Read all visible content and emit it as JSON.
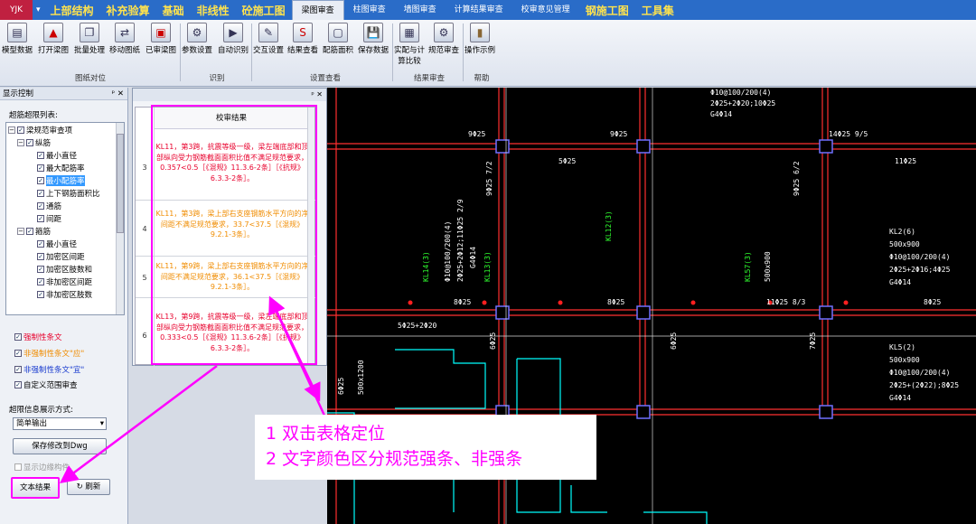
{
  "menubar": {
    "logo": "YJK",
    "items": [
      "上部结构",
      "补充验算",
      "基础",
      "非线性",
      "砼施工图"
    ],
    "tabs": [
      "梁图审查",
      "柱图审查",
      "墙图审查",
      "计算结果审查",
      "校审意见管理"
    ],
    "items2": [
      "钢施工图",
      "工具集"
    ]
  },
  "ribbon": {
    "buttons": [
      "模型数据",
      "打开梁图",
      "批量处理",
      "移动图纸",
      "已审梁图",
      "参数设置",
      "自动识别",
      "交互设置",
      "结果查看",
      "配筋面积",
      "保存数据",
      "实配与计算比较",
      "规范审查",
      "操作示例"
    ],
    "groups": [
      "图纸对位",
      "识别",
      "设置查看",
      "结果审查",
      "帮助"
    ]
  },
  "left_panel": {
    "title": "显示控制",
    "list_label": "超筋超限列表:",
    "tree": [
      "梁规范审查项",
      "纵筋",
      "最小直径",
      "最大配筋率",
      "最小配筋率",
      "上下钢筋面积比",
      "通筋",
      "间距",
      "箍筋",
      "最小直径",
      "加密区间距",
      "加密区肢数和",
      "非加密区间距",
      "非加密区肢数"
    ],
    "checks": [
      "强制性条文",
      "非强制性条文\"应\"",
      "非强制性条文\"宜\"",
      "自定义范围审查"
    ],
    "display_mode_label": "超限信息展示方式:",
    "display_mode_value": "简单输出",
    "save_button": "保存修改到Dwg",
    "show_boundary": "显示边缘构件",
    "text_result_button": "文本结果",
    "refresh_button": "刷新"
  },
  "colors": {
    "strong": "#e8002c",
    "should": "#f08c00",
    "advisory": "#1a3ccf",
    "annot": "#ff00ff"
  },
  "results": {
    "header": "校审结果",
    "rows": [
      {
        "num": "3",
        "text": "KL11，第3跨，抗震等级一级，梁左端底部和顶部纵向受力钢筋截面面积比值不满足规范要求，0.357<0.5［《混规》11.3.6-2条］［《抗规》6.3.3-2条］。",
        "level": "strong"
      },
      {
        "num": "4",
        "text": "KL11，第3跨，梁上部右支座钢筋水平方向的净间距不满足规范要求，33.7<37.5［《混规》9.2.1-3条］。",
        "level": "should"
      },
      {
        "num": "5",
        "text": "KL11，第9跨，梁上部右支座钢筋水平方向的净间距不满足规范要求，36.1<37.5［《混规》9.2.1-3条］。",
        "level": "should"
      },
      {
        "num": "6",
        "text": "KL13，第9跨，抗震等级一级，梁左端底部和顶部纵向受力钢筋截面面积比值不满足规范要求，0.333<0.5［《混规》11.3.6-2条］［《抗规》6.3.3-2条］。",
        "level": "strong"
      }
    ]
  },
  "annotation": {
    "line1": "1 双击表格定位",
    "line2": "2 文字颜色区分规范强条、非强条"
  },
  "cad_labels": [
    "Φ10@100/200(4)",
    "2Φ25+2Φ20;10Φ25",
    "G4Φ14",
    "14Φ25 9/5",
    "9Φ25",
    "9Φ25",
    "5Φ25",
    "11Φ25",
    "KL2(6)",
    "500x900",
    "Φ10@100/200(4)",
    "2Φ25+2Φ16;4Φ25",
    "G4Φ14",
    "8Φ25",
    "8Φ25",
    "11Φ25 8/3",
    "8Φ25",
    "5Φ25+2Φ20",
    "KL5(2)",
    "500x900",
    "Φ10@100/200(4)",
    "2Φ25+(2Φ22);8Φ25",
    "G4Φ14",
    "KL14(3)",
    "KL13(3)",
    "KL12(3)",
    "KL57(3)",
    "500x900",
    "9Φ25 7/2",
    "9Φ25 6/2",
    "Φ10@100/200(4)",
    "2Φ25+2Φ12;11Φ25 2/9",
    "G4Φ14",
    "500x1200",
    "6Φ25",
    "6Φ25",
    "7Φ25",
    "6Φ25"
  ]
}
